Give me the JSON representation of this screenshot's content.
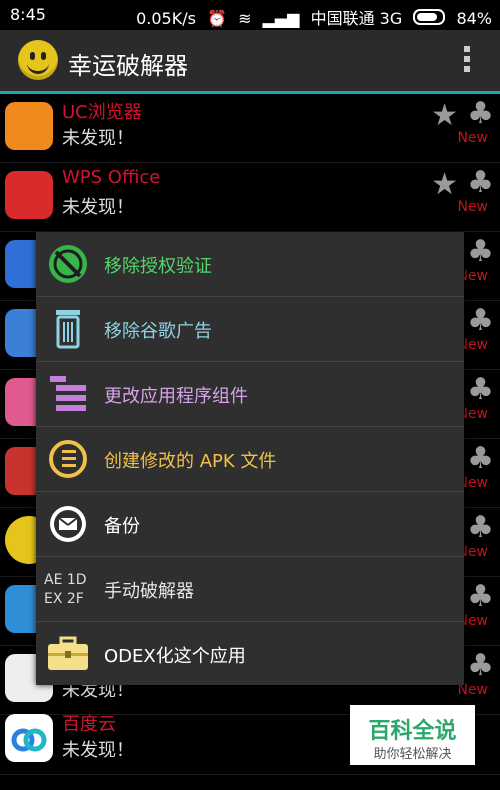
{
  "status_bar": {
    "time": "8:45",
    "speed": "0.05K/s",
    "carrier": "中国联通 3G",
    "battery": "84%"
  },
  "app_bar": {
    "title": "幸运破解器"
  },
  "apps": [
    {
      "name": "UC浏览器",
      "status": "未发现！",
      "badge": "New",
      "icon_color": "#f08a1c"
    },
    {
      "name": "WPS Office",
      "status": "未发现！",
      "badge": "New",
      "icon_color": "#d92b2b"
    },
    {
      "name": "",
      "status": "",
      "badge": "New",
      "icon_color": "#2f6fd6"
    },
    {
      "name": "",
      "status": "",
      "badge": "New",
      "icon_color": "#3b7fd9"
    },
    {
      "name": "",
      "status": "",
      "badge": "New",
      "icon_color": "#e05a8f"
    },
    {
      "name": "",
      "status": "",
      "badge": "New",
      "icon_color": "#c8322f"
    },
    {
      "name": "",
      "status": "",
      "badge": "New",
      "icon_color": "#e5c51c"
    },
    {
      "name": "",
      "status": "",
      "badge": "New",
      "icon_color": "#2f8ed6"
    },
    {
      "name": "",
      "status": "未发现！",
      "badge": "New",
      "icon_color": "#eeeeee"
    },
    {
      "name": "百度云",
      "status": "未发现！",
      "badge": "",
      "icon_color": "#2d7fe0"
    }
  ],
  "menu": {
    "items": [
      {
        "label": "移除授权验证",
        "color": "#55d66a",
        "icon": "remove-license-icon"
      },
      {
        "label": "移除谷歌广告",
        "color": "#8fd3e3",
        "icon": "trash-icon"
      },
      {
        "label": "更改应用程序组件",
        "color": "#d7a3e8",
        "icon": "components-icon"
      },
      {
        "label": "创建修改的 APK 文件",
        "color": "#f0c04a",
        "icon": "create-apk-icon"
      },
      {
        "label": "备份",
        "color": "#ffffff",
        "icon": "backup-icon"
      },
      {
        "label": "手动破解器",
        "color": "#e6e6e6",
        "icon": "hex-code-icon",
        "icon_text": "AE 1D EX 2F"
      },
      {
        "label": "ODEX化这个应用",
        "color": "#ffffff",
        "icon": "toolbox-icon"
      }
    ]
  },
  "watermark": {
    "title": "百科全说",
    "subtitle": "助你轻松解决"
  }
}
